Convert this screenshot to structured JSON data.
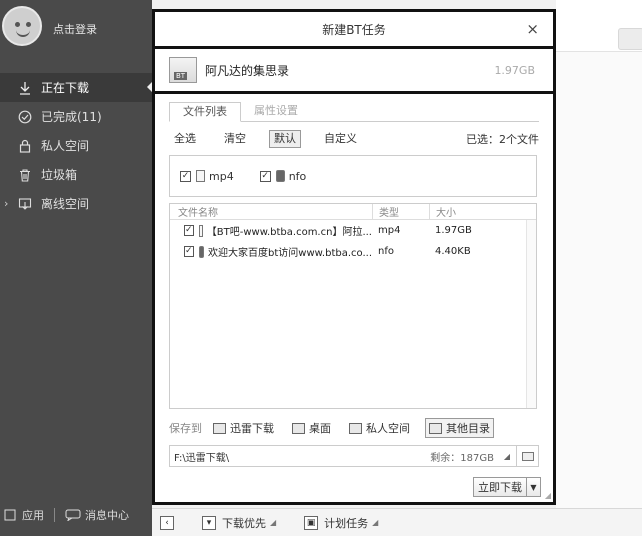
{
  "sidebar": {
    "login_label": "点击登录",
    "items": [
      {
        "label": "正在下载",
        "icon": "download-arrow-icon"
      },
      {
        "label": "已完成(11)",
        "icon": "check-circle-icon"
      },
      {
        "label": "私人空间",
        "icon": "lock-icon"
      },
      {
        "label": "垃圾箱",
        "icon": "trash-icon"
      },
      {
        "label": "离线空间",
        "icon": "cloud-icon"
      }
    ],
    "bottom": {
      "apps_label": "应用",
      "messages_label": "消息中心"
    }
  },
  "dialog": {
    "title": "新建BT任务",
    "close_glyph": "×",
    "task": {
      "icon_badge": "BT",
      "name": "阿凡达的集思录",
      "size": "1.97GB"
    },
    "tabs": [
      {
        "label": "文件列表"
      },
      {
        "label": "属性设置"
      }
    ],
    "filters": {
      "all": "全选",
      "clear": "清空",
      "default": "默认",
      "custom": "自定义",
      "selected": "已选：2个文件"
    },
    "types": [
      {
        "label": "mp4"
      },
      {
        "label": "nfo"
      }
    ],
    "table": {
      "headers": {
        "name": "文件名称",
        "type": "类型",
        "size": "大小"
      },
      "rows": [
        {
          "name": "【BT吧-www.btba.com.cn】阿拉...",
          "type": "mp4",
          "size": "1.97GB"
        },
        {
          "name": "欢迎大家百度bt访问www.btba.co...",
          "type": "nfo",
          "size": "4.40KB"
        }
      ]
    },
    "save": {
      "label": "保存到",
      "destinations": [
        {
          "label": "迅雷下载"
        },
        {
          "label": "桌面"
        },
        {
          "label": "私人空间"
        },
        {
          "label": "其他目录"
        }
      ]
    },
    "path": {
      "value": "F:\\迅雷下载\\",
      "free": "剩余：187GB"
    },
    "download_button": "立即下载"
  },
  "taskbar": {
    "priority_label": "下载优先",
    "scheduled_label": "计划任务"
  }
}
